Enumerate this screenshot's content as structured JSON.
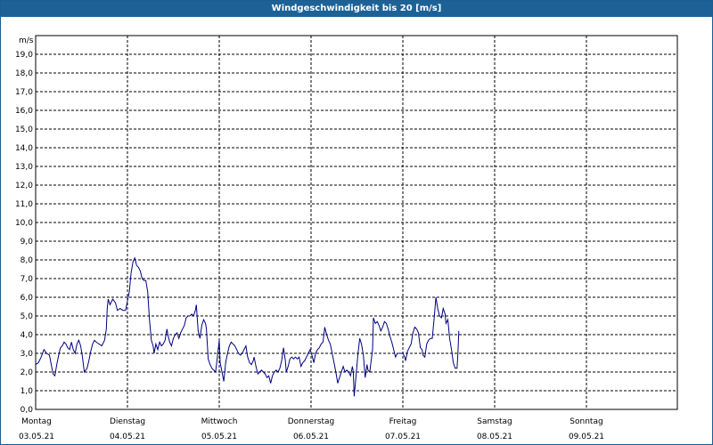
{
  "title": "Windgeschwindigkeit bis 20 [m/s]",
  "chart_data": {
    "type": "line",
    "title": "Windgeschwindigkeit bis 20 [m/s]",
    "ylabel": "m/s",
    "ylim": [
      0,
      20
    ],
    "yticks": [
      "0,0",
      "1,0",
      "2,0",
      "3,0",
      "4,0",
      "5,0",
      "6,0",
      "7,0",
      "8,0",
      "9,0",
      "10,0",
      "11,0",
      "12,0",
      "13,0",
      "14,0",
      "15,0",
      "16,0",
      "17,0",
      "18,0",
      "19,0"
    ],
    "xlim": [
      0,
      7
    ],
    "x_labels": [
      {
        "day": "Montag",
        "date": "03.05.21",
        "x": 0
      },
      {
        "day": "Dienstag",
        "date": "04.05.21",
        "x": 1
      },
      {
        "day": "Mittwoch",
        "date": "05.05.21",
        "x": 2
      },
      {
        "day": "Donnerstag",
        "date": "06.05.21",
        "x": 3
      },
      {
        "day": "Freitag",
        "date": "07.05.21",
        "x": 4
      },
      {
        "day": "Samstag",
        "date": "08.05.21",
        "x": 5
      },
      {
        "day": "Sonntag",
        "date": "09.05.21",
        "x": 6
      }
    ],
    "grid": true,
    "colors": {
      "line": "#000080",
      "grid": "#000000"
    },
    "series": [
      {
        "points": [
          [
            0.0,
            2.4
          ],
          [
            0.03,
            2.5
          ],
          [
            0.06,
            2.8
          ],
          [
            0.09,
            3.2
          ],
          [
            0.12,
            3.0
          ],
          [
            0.15,
            2.9
          ],
          [
            0.17,
            2.4
          ],
          [
            0.19,
            1.9
          ],
          [
            0.21,
            1.8
          ],
          [
            0.23,
            2.4
          ],
          [
            0.25,
            2.9
          ],
          [
            0.27,
            3.3
          ],
          [
            0.29,
            3.4
          ],
          [
            0.31,
            3.6
          ],
          [
            0.33,
            3.5
          ],
          [
            0.35,
            3.3
          ],
          [
            0.37,
            3.2
          ],
          [
            0.39,
            3.6
          ],
          [
            0.41,
            3.2
          ],
          [
            0.43,
            3.0
          ],
          [
            0.45,
            3.5
          ],
          [
            0.47,
            3.7
          ],
          [
            0.49,
            3.4
          ],
          [
            0.51,
            2.8
          ],
          [
            0.53,
            2.0
          ],
          [
            0.56,
            2.2
          ],
          [
            0.58,
            2.6
          ],
          [
            0.6,
            3.1
          ],
          [
            0.62,
            3.5
          ],
          [
            0.64,
            3.7
          ],
          [
            0.66,
            3.6
          ],
          [
            0.69,
            3.5
          ],
          [
            0.72,
            3.4
          ],
          [
            0.75,
            3.7
          ],
          [
            0.77,
            4.3
          ],
          [
            0.78,
            5.4
          ],
          [
            0.79,
            5.9
          ],
          [
            0.81,
            5.6
          ],
          [
            0.84,
            5.9
          ],
          [
            0.87,
            5.7
          ],
          [
            0.89,
            5.3
          ],
          [
            0.92,
            5.4
          ],
          [
            0.95,
            5.3
          ],
          [
            0.98,
            5.3
          ],
          [
            1.0,
            5.8
          ],
          [
            1.02,
            6.3
          ],
          [
            1.04,
            7.3
          ],
          [
            1.06,
            7.9
          ],
          [
            1.08,
            8.1
          ],
          [
            1.1,
            7.7
          ],
          [
            1.12,
            7.6
          ],
          [
            1.14,
            7.4
          ],
          [
            1.16,
            7.0
          ],
          [
            1.18,
            6.9
          ],
          [
            1.2,
            6.9
          ],
          [
            1.22,
            6.3
          ],
          [
            1.24,
            4.8
          ],
          [
            1.26,
            3.7
          ],
          [
            1.28,
            3.4
          ],
          [
            1.29,
            3.0
          ],
          [
            1.31,
            3.5
          ],
          [
            1.33,
            3.2
          ],
          [
            1.35,
            3.6
          ],
          [
            1.37,
            3.4
          ],
          [
            1.39,
            3.5
          ],
          [
            1.41,
            3.7
          ],
          [
            1.43,
            4.3
          ],
          [
            1.44,
            4.0
          ],
          [
            1.46,
            3.6
          ],
          [
            1.48,
            3.4
          ],
          [
            1.5,
            3.8
          ],
          [
            1.52,
            4.0
          ],
          [
            1.54,
            4.1
          ],
          [
            1.56,
            3.8
          ],
          [
            1.58,
            4.1
          ],
          [
            1.6,
            4.3
          ],
          [
            1.62,
            4.5
          ],
          [
            1.64,
            4.9
          ],
          [
            1.66,
            5.0
          ],
          [
            1.68,
            5.0
          ],
          [
            1.7,
            5.1
          ],
          [
            1.72,
            5.0
          ],
          [
            1.74,
            5.3
          ],
          [
            1.75,
            5.6
          ],
          [
            1.77,
            4.2
          ],
          [
            1.79,
            3.8
          ],
          [
            1.81,
            4.5
          ],
          [
            1.83,
            4.8
          ],
          [
            1.85,
            4.6
          ],
          [
            1.86,
            4.3
          ],
          [
            1.88,
            2.7
          ],
          [
            1.9,
            2.4
          ],
          [
            1.92,
            2.2
          ],
          [
            1.94,
            2.1
          ],
          [
            1.96,
            2.0
          ],
          [
            1.98,
            2.8
          ],
          [
            2.0,
            3.7
          ],
          [
            2.01,
            2.5
          ],
          [
            2.03,
            2.0
          ],
          [
            2.05,
            1.5
          ],
          [
            2.07,
            2.5
          ],
          [
            2.09,
            3.0
          ],
          [
            2.11,
            3.4
          ],
          [
            2.13,
            3.6
          ],
          [
            2.15,
            3.5
          ],
          [
            2.17,
            3.4
          ],
          [
            2.19,
            3.2
          ],
          [
            2.21,
            3.0
          ],
          [
            2.23,
            2.9
          ],
          [
            2.25,
            3.0
          ],
          [
            2.27,
            3.2
          ],
          [
            2.29,
            3.4
          ],
          [
            2.31,
            2.8
          ],
          [
            2.33,
            2.5
          ],
          [
            2.35,
            2.4
          ],
          [
            2.37,
            2.6
          ],
          [
            2.38,
            2.8
          ],
          [
            2.4,
            2.3
          ],
          [
            2.42,
            1.9
          ],
          [
            2.44,
            2.0
          ],
          [
            2.46,
            2.1
          ],
          [
            2.48,
            2.0
          ],
          [
            2.5,
            1.9
          ],
          [
            2.52,
            1.7
          ],
          [
            2.54,
            1.8
          ],
          [
            2.56,
            1.4
          ],
          [
            2.58,
            1.8
          ],
          [
            2.6,
            2.0
          ],
          [
            2.62,
            2.1
          ],
          [
            2.64,
            2.0
          ],
          [
            2.66,
            2.2
          ],
          [
            2.68,
            2.6
          ],
          [
            2.7,
            3.3
          ],
          [
            2.72,
            2.6
          ],
          [
            2.73,
            2.0
          ],
          [
            2.75,
            2.3
          ],
          [
            2.77,
            2.7
          ],
          [
            2.79,
            2.8
          ],
          [
            2.81,
            2.7
          ],
          [
            2.83,
            2.8
          ],
          [
            2.85,
            2.7
          ],
          [
            2.87,
            2.8
          ],
          [
            2.89,
            2.3
          ],
          [
            2.91,
            2.5
          ],
          [
            2.93,
            2.6
          ],
          [
            2.95,
            2.8
          ],
          [
            2.97,
            3.0
          ],
          [
            2.99,
            3.2
          ],
          [
            3.01,
            2.9
          ],
          [
            3.03,
            2.5
          ],
          [
            3.05,
            3.0
          ],
          [
            3.07,
            3.2
          ],
          [
            3.09,
            3.3
          ],
          [
            3.11,
            3.5
          ],
          [
            3.13,
            3.6
          ],
          [
            3.15,
            4.4
          ],
          [
            3.17,
            4.0
          ],
          [
            3.19,
            3.7
          ],
          [
            3.21,
            3.5
          ],
          [
            3.23,
            3.0
          ],
          [
            3.25,
            2.5
          ],
          [
            3.27,
            2.0
          ],
          [
            3.29,
            1.4
          ],
          [
            3.31,
            1.7
          ],
          [
            3.33,
            2.0
          ],
          [
            3.35,
            2.3
          ],
          [
            3.37,
            2.0
          ],
          [
            3.39,
            2.1
          ],
          [
            3.41,
            2.0
          ],
          [
            3.43,
            1.8
          ],
          [
            3.45,
            2.3
          ],
          [
            3.46,
            2.0
          ],
          [
            3.47,
            0.7
          ],
          [
            3.49,
            1.8
          ],
          [
            3.51,
            2.9
          ],
          [
            3.53,
            3.8
          ],
          [
            3.55,
            3.5
          ],
          [
            3.57,
            2.9
          ],
          [
            3.59,
            1.7
          ],
          [
            3.61,
            2.4
          ],
          [
            3.62,
            2.1
          ],
          [
            3.64,
            2.0
          ],
          [
            3.65,
            2.4
          ],
          [
            3.67,
            3.2
          ],
          [
            3.68,
            4.9
          ],
          [
            3.7,
            4.6
          ],
          [
            3.72,
            4.7
          ],
          [
            3.74,
            4.5
          ],
          [
            3.76,
            4.2
          ],
          [
            3.78,
            4.4
          ],
          [
            3.8,
            4.7
          ],
          [
            3.82,
            4.6
          ],
          [
            3.84,
            4.3
          ],
          [
            3.86,
            3.9
          ],
          [
            3.88,
            3.6
          ],
          [
            3.9,
            3.2
          ],
          [
            3.92,
            2.8
          ],
          [
            3.94,
            3.0
          ],
          [
            3.96,
            3.0
          ],
          [
            3.98,
            3.0
          ],
          [
            4.0,
            3.0
          ],
          [
            4.02,
            2.8
          ],
          [
            4.03,
            2.6
          ],
          [
            4.05,
            3.1
          ],
          [
            4.07,
            3.3
          ],
          [
            4.09,
            3.5
          ],
          [
            4.11,
            4.1
          ],
          [
            4.13,
            4.4
          ],
          [
            4.15,
            4.3
          ],
          [
            4.17,
            4.1
          ],
          [
            4.19,
            3.3
          ],
          [
            4.21,
            3.2
          ],
          [
            4.22,
            2.9
          ],
          [
            4.24,
            2.8
          ],
          [
            4.26,
            3.5
          ],
          [
            4.28,
            3.7
          ],
          [
            4.3,
            3.8
          ],
          [
            4.32,
            3.8
          ],
          [
            4.34,
            4.8
          ],
          [
            4.36,
            6.0
          ],
          [
            4.38,
            5.4
          ],
          [
            4.4,
            5.0
          ],
          [
            4.42,
            4.9
          ],
          [
            4.44,
            5.4
          ],
          [
            4.46,
            5.1
          ],
          [
            4.47,
            4.6
          ],
          [
            4.49,
            4.8
          ],
          [
            4.51,
            3.8
          ],
          [
            4.53,
            3.2
          ],
          [
            4.55,
            2.5
          ],
          [
            4.57,
            2.2
          ],
          [
            4.59,
            2.2
          ],
          [
            4.6,
            3.0
          ],
          [
            4.61,
            4.2
          ]
        ]
      }
    ]
  }
}
